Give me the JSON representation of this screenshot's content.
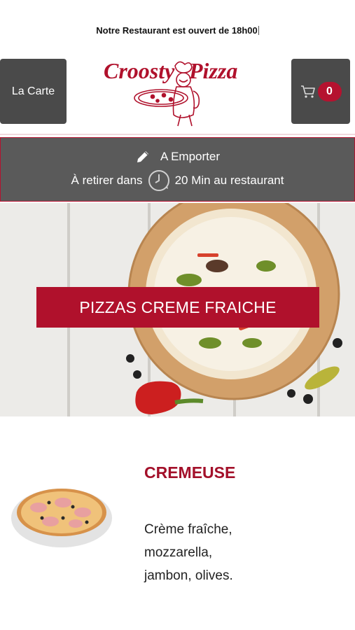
{
  "header": {
    "notice": "Notre Restaurant est ouvert de 18h00",
    "menu_button": "La Carte",
    "cart_count": "0",
    "logo_text": "Croosty Pizza"
  },
  "order": {
    "mode": "A Emporter",
    "pickup_prefix": "À retirer dans",
    "pickup_suffix": "20 Min au restaurant"
  },
  "hero": {
    "category": "PIZZAS CREME FRAICHE"
  },
  "product": {
    "name": "CREMEUSE",
    "description": "Crème fraîche, mozzarella, jambon, olives."
  },
  "colors": {
    "brand": "#b0112c",
    "dark_button": "#4a4a4a",
    "order_box": "#5a5a5a"
  },
  "icons": [
    "cart-icon",
    "pencil-icon",
    "clock-icon",
    "chef-mascot-icon"
  ]
}
